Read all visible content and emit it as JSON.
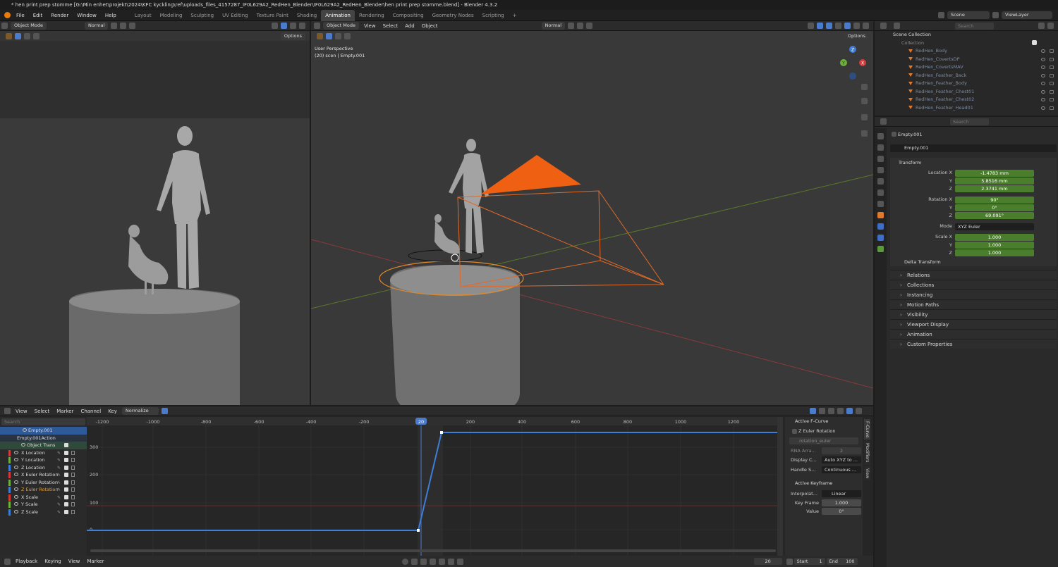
{
  "window_title": "* hen print prep stomme [G:\\Min enhet\\projekt\\2024\\KFC kyckling\\ref\\uploads_files_4157287_IF0L629A2_RedHen_Blender\\IF0L629A2_RedHen_Blender\\hen print prep stomme.blend] - Blender 4.3.2",
  "menu": [
    "File",
    "Edit",
    "Render",
    "Window",
    "Help"
  ],
  "workspaces": [
    "Layout",
    "Modeling",
    "Sculpting",
    "UV Editing",
    "Texture Paint",
    "Shading",
    "Animation",
    "Rendering",
    "Compositing",
    "Geometry Nodes",
    "Scripting"
  ],
  "active_workspace": "Animation",
  "scene": {
    "label": "Scene",
    "view_layer": "ViewLayer"
  },
  "vp1": {
    "mode": "Object Mode",
    "orientation": "Normal",
    "options": "Options"
  },
  "vp2": {
    "mode": "Object Mode",
    "menus": [
      "View",
      "Select",
      "Add",
      "Object"
    ],
    "orientation": "Normal",
    "options": "Options",
    "perspective": "User Perspective",
    "info": "(20) scen | Empty.001"
  },
  "gizmo": {
    "z": "Z",
    "x": "X",
    "y": "Y"
  },
  "outliner": {
    "search_placeholder": "Search",
    "root": "Scene Collection",
    "collection": "Collection",
    "items": [
      "RedHen_Body",
      "RedHen_CovertsDP",
      "RedHen_CovertsMAV",
      "RedHen_Feather_Back",
      "RedHen_Feather_Body",
      "RedHen_Feather_Chest01",
      "RedHen_Feather_Chest02",
      "RedHen_Feather_Head01"
    ]
  },
  "props": {
    "search_placeholder": "Search",
    "object_name": "Empty.001",
    "object_field": "Empty.001",
    "transform_label": "Transform",
    "location_label": "Location X",
    "location": [
      "-1.4783 mm",
      "5.8516 mm",
      "2.3741 mm"
    ],
    "rotation_label": "Rotation X",
    "rotation": [
      "90°",
      "0°",
      "69.091°"
    ],
    "mode_label": "Mode",
    "mode_value": "XYZ Euler",
    "scale_label": "Scale X",
    "scale": [
      "1.000",
      "1.000",
      "1.000"
    ],
    "axis_y": "Y",
    "axis_z": "Z",
    "delta": "Delta Transform",
    "panels": [
      "Relations",
      "Collections",
      "Instancing",
      "Motion Paths",
      "Visibility",
      "Viewport Display",
      "Animation",
      "Custom Properties"
    ]
  },
  "graph": {
    "menus": [
      "View",
      "Select",
      "Marker",
      "Channel",
      "Key"
    ],
    "normalize": "Normalize",
    "search_placeholder": "Search",
    "frame_ticks": [
      "-1200",
      "-1000",
      "-800",
      "-600",
      "-400",
      "-200",
      "200",
      "400",
      "600",
      "800",
      "1000",
      "1200"
    ],
    "current_frame": "20",
    "value_ticks": [
      "300",
      "200",
      "100",
      "0"
    ],
    "channels": {
      "object": "Empty.001",
      "action": "Empty.001Action",
      "group": "Object Trans",
      "curves": [
        {
          "name": "X Location",
          "color": "#d23c3c"
        },
        {
          "name": "Y Location",
          "color": "#6cb13a"
        },
        {
          "name": "Z Location",
          "color": "#3d7ed8"
        },
        {
          "name": "X Euler Rotation",
          "color": "#d23c3c"
        },
        {
          "name": "Y Euler Rotation",
          "color": "#6cb13a"
        },
        {
          "name": "Z Euler Rotation",
          "color": "#3d7ed8"
        },
        {
          "name": "X Scale",
          "color": "#d23c3c"
        },
        {
          "name": "Y Scale",
          "color": "#6cb13a"
        },
        {
          "name": "Z Scale",
          "color": "#3d7ed8"
        }
      ]
    },
    "sidebar": {
      "active_fcurve": "Active F-Curve",
      "curve_name": "Z Euler Rotation",
      "path": "rotation_euler",
      "rna_label": "RNA Arra...",
      "rna_value": "2",
      "display_label": "Display C...",
      "display_value": "Auto XYZ to ...",
      "handle_label": "Handle S...",
      "handle_value": "Continuous ...",
      "active_keyframe": "Active Keyframe",
      "interp_label": "Interpolat...",
      "interp_value": "Linear",
      "keyframe_label": "Key Frame",
      "keyframe_value": "1.000",
      "value_label": "Value",
      "value_value": "0°",
      "tabs": [
        "F-Curve",
        "Modifiers",
        "View"
      ]
    }
  },
  "timeline": {
    "menus": [
      "Playback",
      "Keying",
      "View",
      "Marker"
    ],
    "frame": "20",
    "start_label": "Start",
    "start": "1",
    "end_label": "End",
    "end": "100"
  }
}
